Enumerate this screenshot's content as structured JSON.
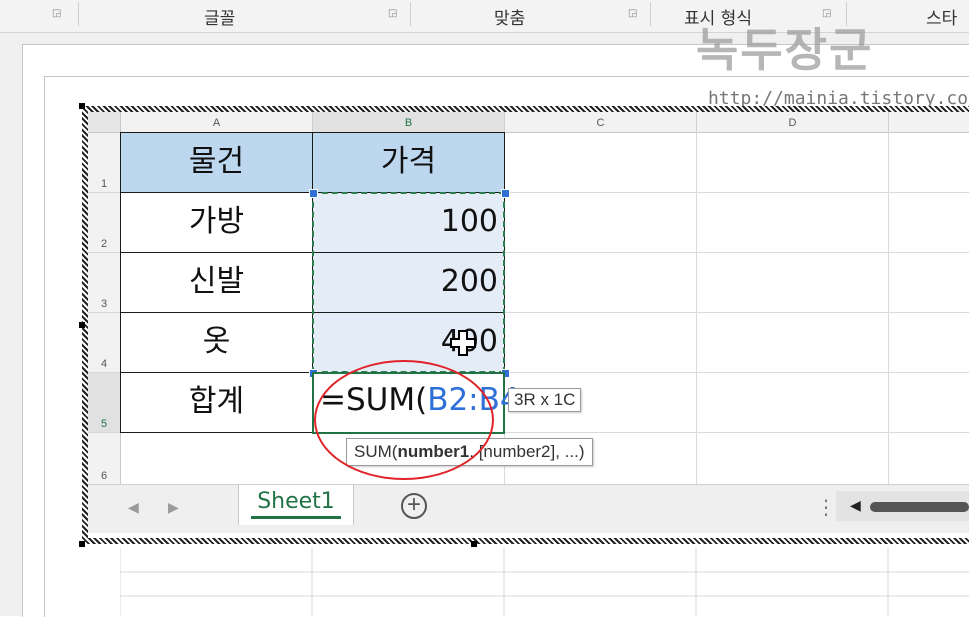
{
  "ribbon": {
    "groups": [
      "글꼴",
      "맞춤",
      "표시 형식",
      "스타"
    ],
    "launcher_icon": "dialog-launcher-icon"
  },
  "watermark": {
    "text": "녹두장군",
    "url": "http://mainia.tistory.com"
  },
  "grid": {
    "columns": [
      "A",
      "B",
      "C",
      "D"
    ],
    "rows": [
      "1",
      "2",
      "3",
      "4",
      "5",
      "6"
    ]
  },
  "table": {
    "headers": [
      "물건",
      "가격"
    ],
    "rows": [
      {
        "item": "가방",
        "price": "100"
      },
      {
        "item": "신발",
        "price": "200"
      },
      {
        "item": "옷",
        "price": "400"
      }
    ],
    "total_label": "합계"
  },
  "formula": {
    "prefix": "=SUM(",
    "ref": "B2:B4"
  },
  "tooltips": {
    "range_size": "3R x 1C",
    "function_hint_name": "SUM(",
    "function_hint_bold": "number1",
    "function_hint_rest": ", [number2], ...)"
  },
  "sheet_tabs": {
    "active": "Sheet1",
    "add_icon": "plus-circle-icon"
  },
  "colors": {
    "accent": "#217346",
    "header_fill": "#bdd7ee",
    "range_fill": "#e4ecf8",
    "highlight_oval": "#e0242a",
    "ref_blue": "#2e6fd8"
  }
}
